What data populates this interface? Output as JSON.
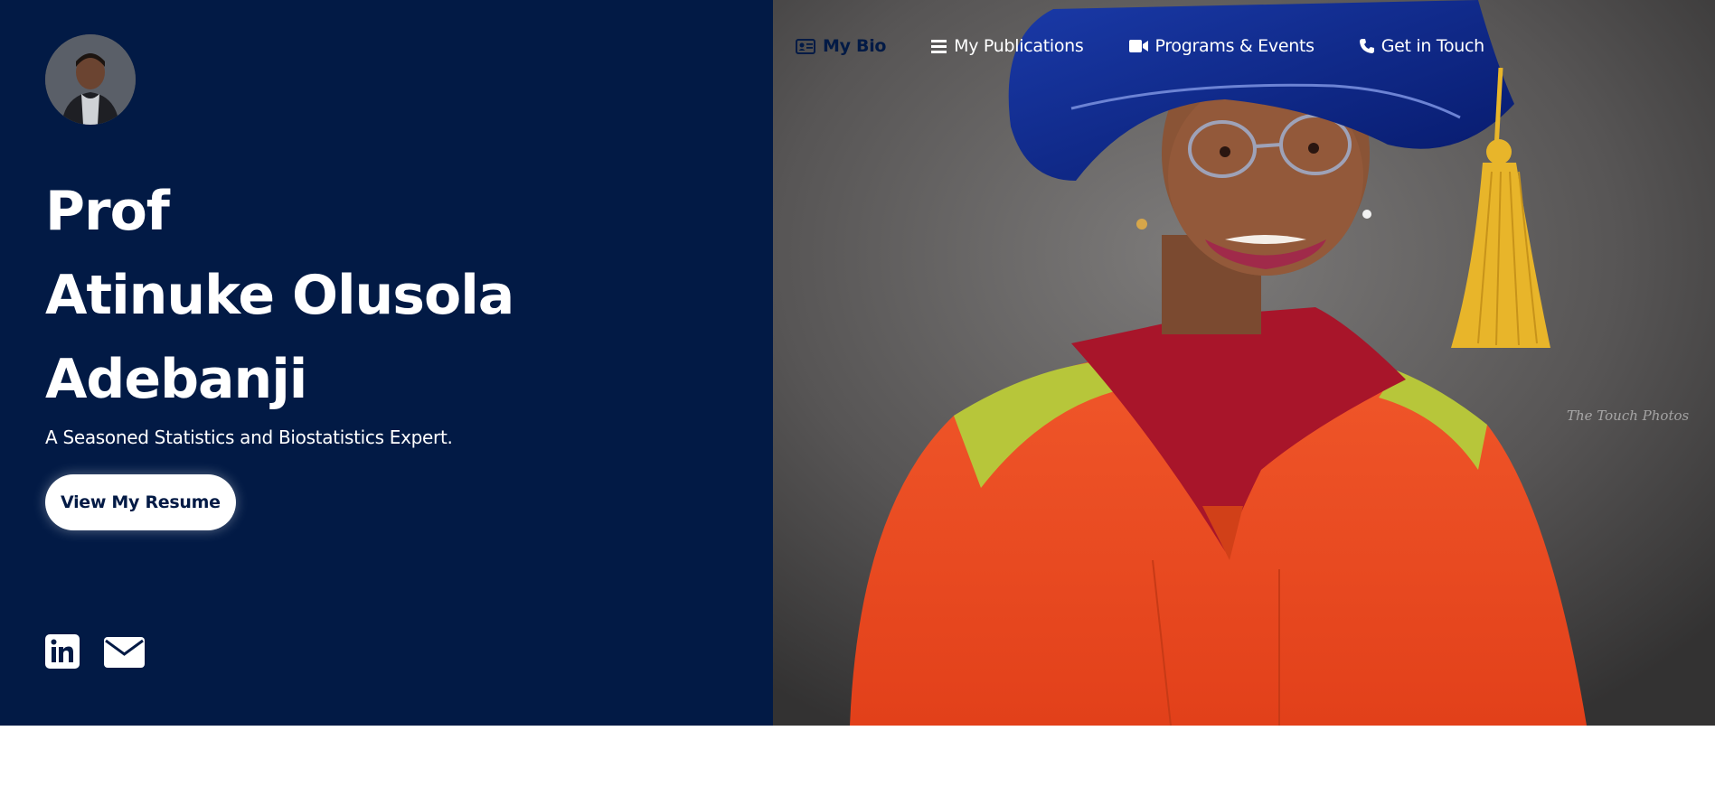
{
  "profile": {
    "avatar_icon": "avatar-photo",
    "name_lines": [
      "Prof",
      "Atinuke Olusola",
      "Adebanji"
    ],
    "tagline": "A Seasoned Statistics and Biostatistics Expert.",
    "resume_label": "View My Resume"
  },
  "nav": {
    "items": [
      {
        "label": "My Bio",
        "icon": "id-card-icon",
        "active": true
      },
      {
        "label": "My Publications",
        "icon": "list-icon",
        "active": false
      },
      {
        "label": "Programs & Events",
        "icon": "video-camera-icon",
        "active": false
      },
      {
        "label": "Get in Touch",
        "icon": "phone-icon",
        "active": false
      }
    ]
  },
  "social": {
    "linkedin_icon": "linkedin-icon",
    "email_icon": "envelope-icon"
  },
  "hero_photo": {
    "watermark": "The Touch Photos"
  },
  "colors": {
    "primary": "#021a45",
    "white": "#ffffff",
    "gown": "#e8451f",
    "cap": "#0b2a8a",
    "tassel": "#e8b52a"
  }
}
